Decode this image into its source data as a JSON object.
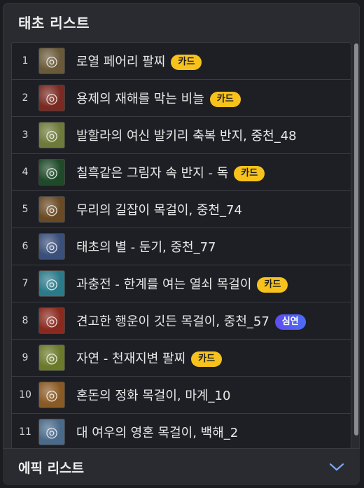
{
  "main": {
    "title": "태초 리스트"
  },
  "items": [
    {
      "rank": "1",
      "name": "로열 페어리 팔찌",
      "badge": "카드",
      "badge_type": "card",
      "icon": "bracelet-icon",
      "color": "#6a5a3a"
    },
    {
      "rank": "2",
      "name": "용제의 재해를 막는 비늘",
      "badge": "카드",
      "badge_type": "card",
      "icon": "scale-bracelet-icon",
      "color": "#7a2a22"
    },
    {
      "rank": "3",
      "name": "발할라의 여신 발키리 축복 반지, 중천_48",
      "badge": "",
      "badge_type": "",
      "icon": "ring-icon",
      "color": "#6d7a3a"
    },
    {
      "rank": "4",
      "name": "칠흑같은 그림자 속 반지 - 독",
      "badge": "카드",
      "badge_type": "card",
      "icon": "shadow-ring-icon",
      "color": "#1f4a2a"
    },
    {
      "rank": "5",
      "name": "무리의 길잡이 목걸이, 중천_74",
      "badge": "",
      "badge_type": "",
      "icon": "necklace-icon",
      "color": "#6a4a24"
    },
    {
      "rank": "6",
      "name": "태초의 별 - 둔기, 중천_77",
      "badge": "",
      "badge_type": "",
      "icon": "star-mace-icon",
      "color": "#3a4f7a"
    },
    {
      "rank": "7",
      "name": "과충전 - 한계를 여는 열쇠 목걸이",
      "badge": "카드",
      "badge_type": "card",
      "icon": "key-necklace-icon",
      "color": "#2a7a8a"
    },
    {
      "rank": "8",
      "name": "견고한 행운이 깃든 목걸이, 중천_57",
      "badge": "심연",
      "badge_type": "deep",
      "icon": "luck-necklace-icon",
      "color": "#8a2a1f"
    },
    {
      "rank": "9",
      "name": "자연 - 천재지변 팔찌",
      "badge": "카드",
      "badge_type": "card",
      "icon": "nature-bracelet-icon",
      "color": "#6a7a2a"
    },
    {
      "rank": "10",
      "name": "혼돈의 정화 목걸이, 마계_10",
      "badge": "",
      "badge_type": "",
      "icon": "chaos-necklace-icon",
      "color": "#8a5a24"
    },
    {
      "rank": "11",
      "name": "대 여우의 영혼 목걸이, 백해_2",
      "badge": "",
      "badge_type": "",
      "icon": "fox-necklace-icon",
      "color": "#4a6a8a"
    }
  ],
  "footer": {
    "title": "에픽 리스트"
  }
}
